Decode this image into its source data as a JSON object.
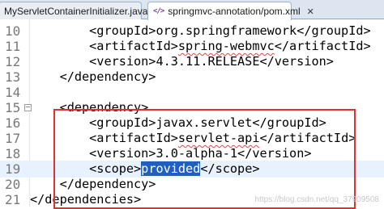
{
  "tabs": [
    {
      "label": "MyServletContainerInitializer.java",
      "active": false
    },
    {
      "label": "springmvc-annotation/pom.xml",
      "active": true,
      "icon": "xml-file-icon",
      "close": "✕"
    }
  ],
  "lines": [
    {
      "num": "10",
      "indent": "        ",
      "open": "<groupId>",
      "text": "org.springframework",
      "close": "</groupId>"
    },
    {
      "num": "11",
      "indent": "        ",
      "open": "<artifactId>",
      "text": "spring-webmvc",
      "close": "</artifactId>"
    },
    {
      "num": "12",
      "indent": "        ",
      "open": "<version>",
      "text": "4.3.11.RELEASE",
      "close": "</version>"
    },
    {
      "num": "13",
      "indent": "    ",
      "open": "</dependency>",
      "text": "",
      "close": ""
    },
    {
      "num": "14",
      "indent": "",
      "open": "",
      "text": "",
      "close": ""
    },
    {
      "num": "15",
      "indent": "    ",
      "open": "<dependency>",
      "text": "",
      "close": ""
    },
    {
      "num": "16",
      "indent": "        ",
      "open": "<groupId>",
      "text": "javax.servlet",
      "close": "</groupId>"
    },
    {
      "num": "17",
      "indent": "        ",
      "open": "<artifactId>",
      "text": "servlet-api",
      "close": "</artifactId>"
    },
    {
      "num": "18",
      "indent": "        ",
      "open": "<version>",
      "text": "3.0-alpha-1",
      "close": "</version>"
    },
    {
      "num": "19",
      "indent": "        ",
      "open": "<scope>",
      "text": "provided",
      "close": "</scope>"
    },
    {
      "num": "20",
      "indent": "    ",
      "open": "</dependency>",
      "text": "",
      "close": ""
    },
    {
      "num": "21",
      "indent": "",
      "open": "</dependencies>",
      "text": "",
      "close": ""
    }
  ],
  "watermark": "https://blog.csdn.net/qq_37909508",
  "colors": {
    "selection": "#1f5fbf",
    "current_line": "#e8f2fe",
    "highlight_box": "#e03030"
  }
}
